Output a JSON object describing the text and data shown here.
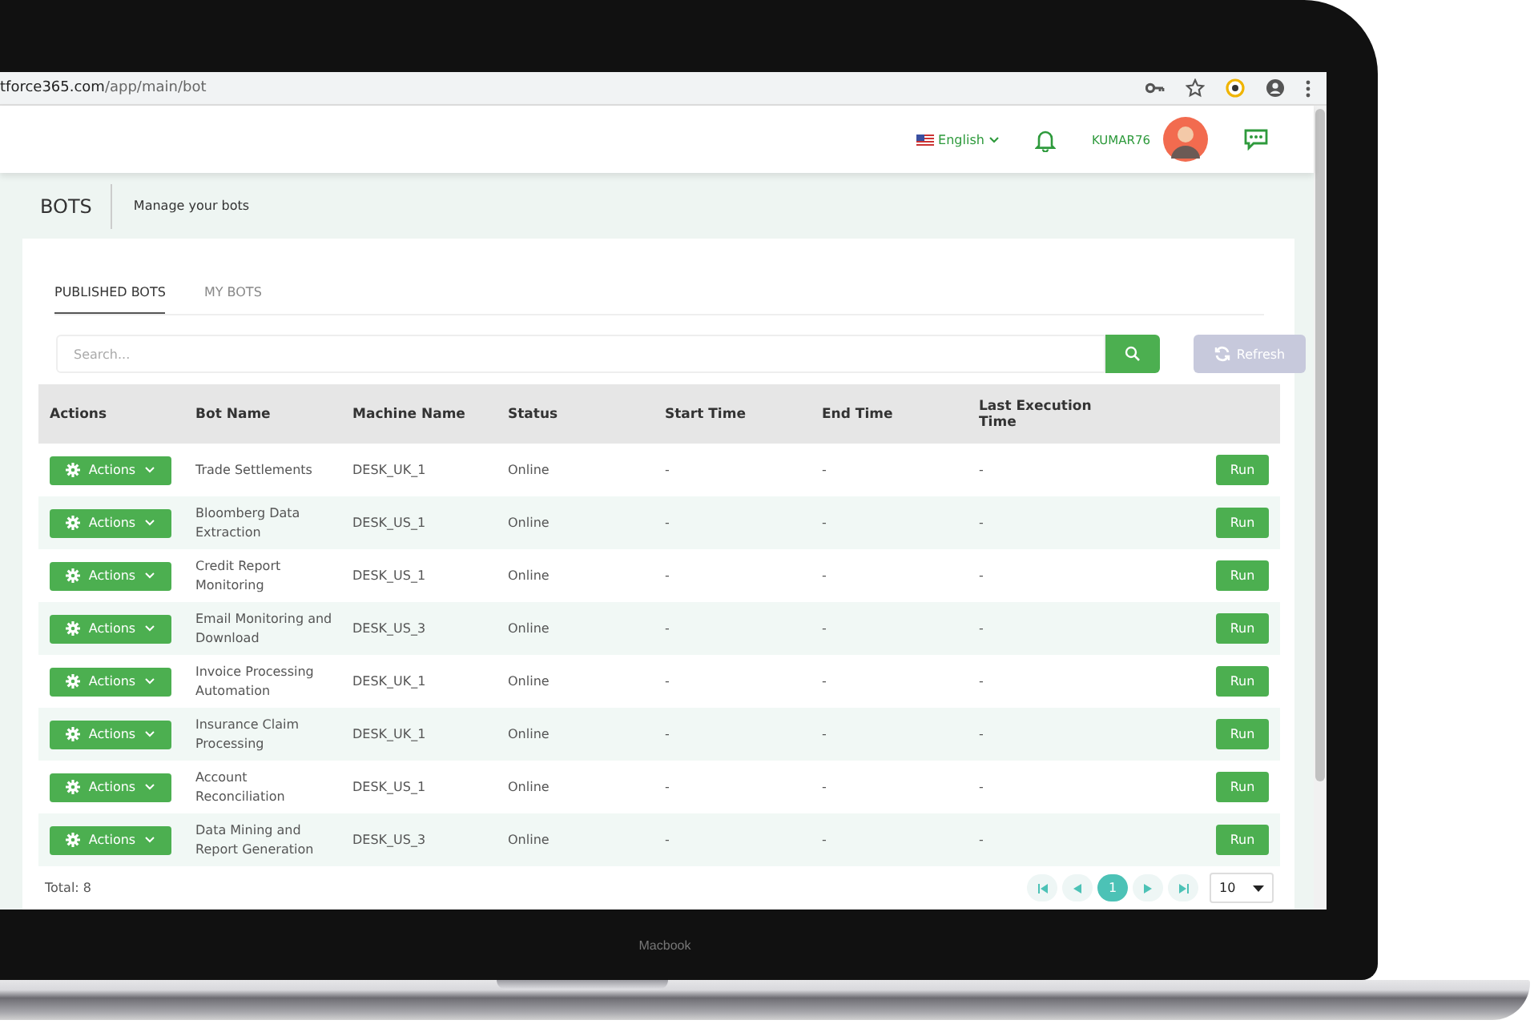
{
  "browser": {
    "url_host": "tforce365.com",
    "url_path": "/app/main/bot"
  },
  "header": {
    "language": "English",
    "username": "KUMAR76"
  },
  "page": {
    "title": "BOTS",
    "subtitle": "Manage your bots"
  },
  "tabs": [
    {
      "label": "PUBLISHED BOTS",
      "selected": true
    },
    {
      "label": "MY BOTS",
      "selected": false
    }
  ],
  "search": {
    "placeholder": "Search..."
  },
  "refresh": {
    "label": "Refresh",
    "disabled": true
  },
  "table": {
    "columns": [
      "Actions",
      "Bot Name",
      "Machine Name",
      "Status",
      "Start Time",
      "End Time",
      "Last Execution Time"
    ],
    "rows": [
      {
        "action_label": "Actions",
        "name": "Trade Settlements",
        "machine": "DESK_UK_1",
        "status": "Online",
        "start": "-",
        "end": "-",
        "last": "-",
        "run_label": "Run"
      },
      {
        "action_label": "Actions",
        "name": "Bloomberg Data Extraction",
        "machine": "DESK_US_1",
        "status": "Online",
        "start": "-",
        "end": "-",
        "last": "-",
        "run_label": "Run"
      },
      {
        "action_label": "Actions",
        "name": "Credit Report Monitoring",
        "machine": "DESK_US_1",
        "status": "Online",
        "start": "-",
        "end": "-",
        "last": "-",
        "run_label": "Run"
      },
      {
        "action_label": "Actions",
        "name": "Email Monitoring and Download",
        "machine": "DESK_US_3",
        "status": "Online",
        "start": "-",
        "end": "-",
        "last": "-",
        "run_label": "Run"
      },
      {
        "action_label": "Actions",
        "name": "Invoice Processing Automation",
        "machine": "DESK_UK_1",
        "status": "Online",
        "start": "-",
        "end": "-",
        "last": "-",
        "run_label": "Run"
      },
      {
        "action_label": "Actions",
        "name": "Insurance Claim Processing",
        "machine": "DESK_UK_1",
        "status": "Online",
        "start": "-",
        "end": "-",
        "last": "-",
        "run_label": "Run"
      },
      {
        "action_label": "Actions",
        "name": "Account Reconciliation",
        "machine": "DESK_US_1",
        "status": "Online",
        "start": "-",
        "end": "-",
        "last": "-",
        "run_label": "Run"
      },
      {
        "action_label": "Actions",
        "name": "Data Mining and Report Generation",
        "machine": "DESK_US_3",
        "status": "Online",
        "start": "-",
        "end": "-",
        "last": "-",
        "run_label": "Run"
      }
    ]
  },
  "footer": {
    "total": "Total: 8",
    "pages": [
      {
        "label": "1",
        "selected": true
      }
    ],
    "page_size": "10"
  },
  "laptop_label": "Macbook"
}
